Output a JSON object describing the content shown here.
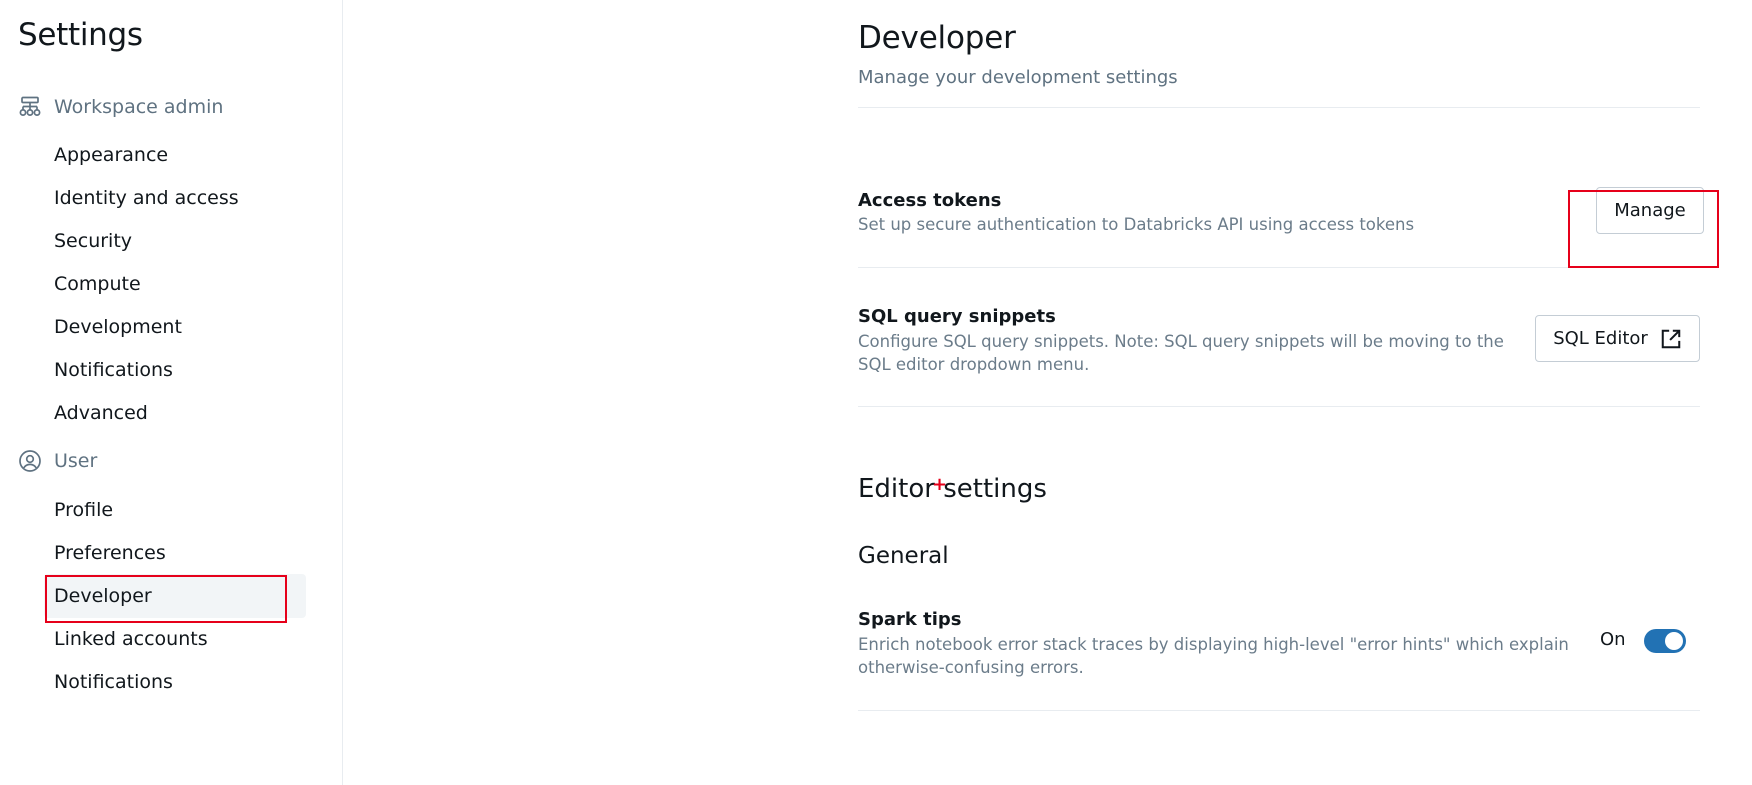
{
  "sidebar": {
    "title": "Settings",
    "workspace_admin": {
      "label": "Workspace admin",
      "icon": "workspace-admin-icon",
      "items": [
        "Appearance",
        "Identity and access",
        "Security",
        "Compute",
        "Development",
        "Notifications",
        "Advanced"
      ]
    },
    "user": {
      "label": "User",
      "icon": "user-circle-icon",
      "items": [
        "Profile",
        "Preferences",
        "Developer",
        "Linked accounts",
        "Notifications"
      ],
      "active": "Developer"
    }
  },
  "page": {
    "title": "Developer",
    "subtitle": "Manage your development settings"
  },
  "access_tokens": {
    "title": "Access tokens",
    "description": "Set up secure authentication to Databricks API using access tokens",
    "button": "Manage"
  },
  "sql_snippets": {
    "title": "SQL query snippets",
    "description_line1": "Configure SQL query snippets. Note: SQL query snippets will be moving to the",
    "description_line2": "SQL editor dropdown menu.",
    "button": "SQL Editor",
    "button_icon": "external-link-icon"
  },
  "editor_settings": {
    "title": "Editor settings",
    "general": "General",
    "spark_tips": {
      "title": "Spark tips",
      "description_line1": "Enrich notebook error stack traces by displaying high-level \"error hints\" which explain",
      "description_line2": "otherwise-confusing errors.",
      "state_label": "On",
      "enabled": true
    }
  },
  "colors": {
    "accent": "#2272b4",
    "highlight": "#e6001a"
  }
}
